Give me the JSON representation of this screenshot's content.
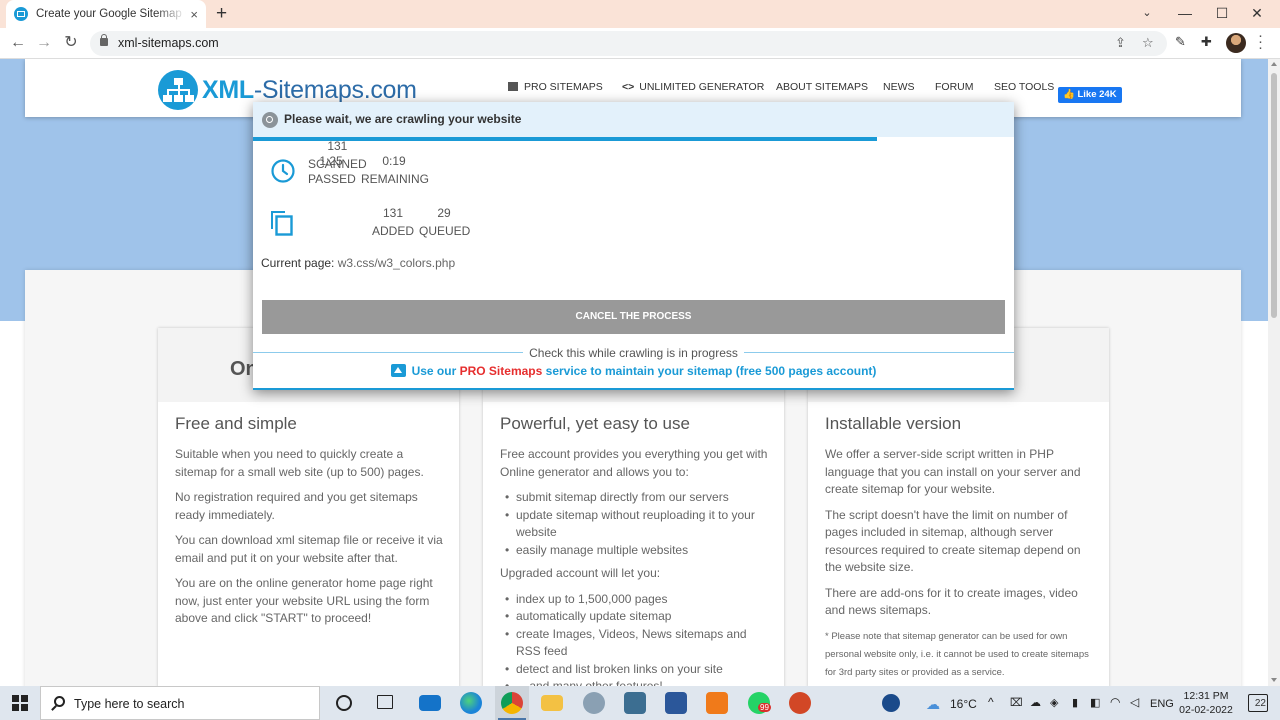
{
  "browser": {
    "tab_title": "Create your Google Sitemap Online - XML Sitemaps Generator",
    "tab_close": "×",
    "new_tab": "+",
    "url": "xml-sitemaps.com",
    "window_controls": {
      "minimize": "—",
      "maximize": "☐",
      "close": "✕"
    }
  },
  "site": {
    "logo_prefix": "XML",
    "logo_rest": "-Sitemaps.com",
    "nav": [
      {
        "label": "PRO SITEMAPS"
      },
      {
        "label": "UNLIMITED GENERATOR"
      },
      {
        "label": "ABOUT SITEMAPS"
      },
      {
        "label": "NEWS"
      },
      {
        "label": "FORUM"
      },
      {
        "label": "SEO TOOLS"
      }
    ],
    "fb_like": "Like 24K"
  },
  "section": {
    "headline_partial": "On"
  },
  "cards": [
    {
      "title": "Free and simple",
      "paragraphs": [
        "Suitable when you need to quickly create a sitemap for a small web site (up to 500) pages.",
        "No registration required and you get sitemaps ready immediately.",
        "You can download xml sitemap file or receive it via email and put it on your website after that.",
        "You are on the online generator home page right now, just enter your website URL using the form above and click \"START\" to proceed!"
      ]
    },
    {
      "title": "Powerful, yet easy to use",
      "intro": "Free account provides you everything you get with Online generator and allows you to:",
      "list1": [
        "submit sitemap directly from our servers",
        "update sitemap without reuploading it to your website",
        "easily manage multiple websites"
      ],
      "upgrade": "Upgraded account will let you:",
      "list2": [
        "index up to 1,500,000 pages",
        "automatically update sitemap",
        "create Images, Videos, News sitemaps and RSS feed",
        "detect and list broken links on your site",
        "... and many other features!"
      ]
    },
    {
      "title": "Installable version",
      "paragraphs": [
        "We offer a server-side script written in PHP language that you can install on your server and create sitemap for your website.",
        "The script doesn't have the limit on number of pages included in sitemap, although server resources required to create sitemap depend on the website size.",
        "There are add-ons for it to create images, video and news sitemaps."
      ],
      "note": "* Please note that sitemap generator can be used for own personal website only, i.e. it cannot be used to create sitemaps for 3rd party sites or provided as a service."
    }
  ],
  "modal": {
    "title": "Please wait, we are crawling your website",
    "progress_fraction": 0.82,
    "time": [
      {
        "value": "1:25",
        "label": "PASSED"
      },
      {
        "value": "0:19",
        "label": "REMAINING"
      }
    ],
    "pages": [
      {
        "value": "131",
        "label": "SCANNED"
      },
      {
        "value": "131",
        "label": "ADDED"
      },
      {
        "value": "29",
        "label": "QUEUED"
      }
    ],
    "current_page_label": "Current page:",
    "current_page_value": "w3.css/w3_colors.php",
    "cancel_label": "CANCEL THE PROCESS",
    "check_label": "Check this while crawling is in progress",
    "pro_prefix": "Use our",
    "pro_highlight": "PRO Sitemaps",
    "pro_suffix": "service to maintain your sitemap (free 500 pages account)"
  },
  "taskbar": {
    "search_placeholder": "Type here to search",
    "weather": "16°C",
    "language": "ENG",
    "time": "12:31 PM",
    "date": "02-02-2022",
    "notifications": "22",
    "whatsapp_badge": "99"
  },
  "colors": {
    "accent": "#1a9ad6",
    "brand_dark": "#1f5f98",
    "pro_red": "#e62e2e",
    "hero_blue": "#9fc3ea",
    "cancel_gray": "#999999"
  }
}
